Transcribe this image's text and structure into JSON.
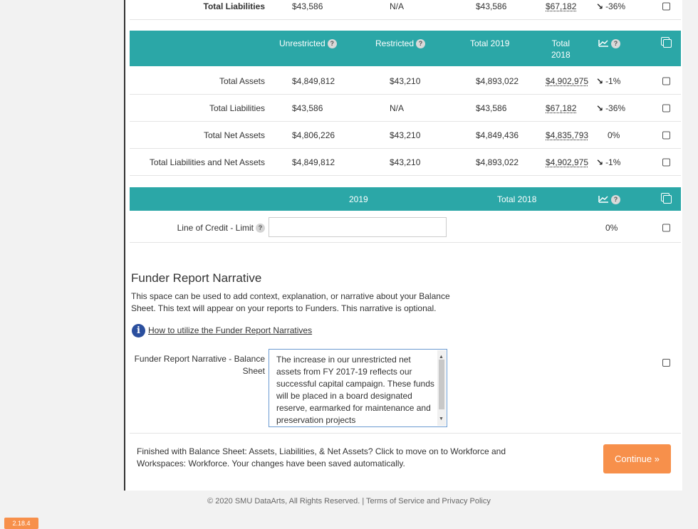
{
  "top_row": {
    "label": "Total Liabilities",
    "unrestricted": "$43,586",
    "restricted": "N/A",
    "total_2019": "$43,586",
    "total_2018": "$67,182",
    "change": "-36%"
  },
  "table1": {
    "headers": {
      "unrestricted": "Unrestricted",
      "restricted": "Restricted",
      "total_2019": "Total 2019",
      "total_2018_line1": "Total",
      "total_2018_line2": "2018"
    },
    "rows": [
      {
        "label": "Total Assets",
        "unrestricted": "$4,849,812",
        "restricted": "$43,210",
        "total_2019": "$4,893,022",
        "total_2018": "$4,902,975",
        "change": "-1%",
        "arrow": "↘"
      },
      {
        "label": "Total Liabilities",
        "unrestricted": "$43,586",
        "restricted": "N/A",
        "total_2019": "$43,586",
        "total_2018": "$67,182",
        "change": "-36%",
        "arrow": "↘"
      },
      {
        "label": "Total Net Assets",
        "unrestricted": "$4,806,226",
        "restricted": "$43,210",
        "total_2019": "$4,849,436",
        "total_2018": "$4,835,793",
        "change": "0%",
        "arrow": ""
      },
      {
        "label": "Total Liabilities and Net Assets",
        "unrestricted": "$4,849,812",
        "restricted": "$43,210",
        "total_2019": "$4,893,022",
        "total_2018": "$4,902,975",
        "change": "-1%",
        "arrow": "↘"
      }
    ]
  },
  "table2": {
    "headers": {
      "year_2019": "2019",
      "total_2018": "Total 2018"
    },
    "row": {
      "label": "Line of Credit - Limit",
      "value": "",
      "change": "0%"
    }
  },
  "narrative": {
    "title": "Funder Report Narrative",
    "description": "This space can be used to add context, explanation, or narrative about your Balance Sheet. This text will appear on your reports to Funders. This narrative is optional.",
    "link": "How to utilize the Funder Report Narratives",
    "field_label": "Funder Report Narrative - Balance Sheet",
    "field_value": "The increase in our unrestricted net assets from FY 2017-19 reflects our successful capital campaign. These funds will be placed in a board designated reserve, earmarked for maintenance and preservation projects"
  },
  "finish": {
    "text": "Finished with Balance Sheet: Assets, Liabilities, & Net Assets? Click to move on to Workforce and Workspaces: Workforce. Your changes have been saved automatically.",
    "button": "Continue »"
  },
  "footer": {
    "copyright": "© 2020 SMU DataArts, All Rights Reserved.  |  Terms of Service and Privacy Policy"
  },
  "version": "2.18.4",
  "colors": {
    "teal": "#2ba7a7",
    "orange": "#f7904b",
    "info_blue": "#2b4f9e"
  },
  "icons": {
    "question": "?",
    "trend": "trend-chart-icon",
    "copy": "copy-icon",
    "info": "i"
  }
}
